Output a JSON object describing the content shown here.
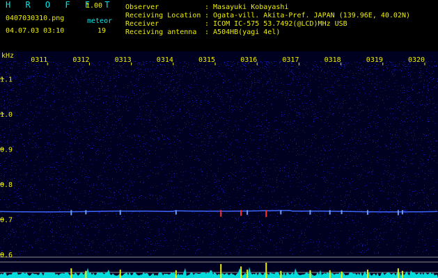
{
  "app": {
    "title": "H R O F F T",
    "version": "1.00",
    "filename": "0407030310.png",
    "datetime": "04.07.03 03:10",
    "meteor_label": "meteor",
    "meteor_count": "19"
  },
  "info": {
    "rows": [
      {
        "label": "Observer",
        "value": ": Masayuki Kobayashi"
      },
      {
        "label": "Receiving Location",
        "value": ": Ogata-vill. Akita-Pref. JAPAN (139.96E, 40.02N)"
      },
      {
        "label": "Receiver",
        "value": ": ICOM IC-575 53.7492(@LCD)MHz USB"
      },
      {
        "label": "Receiving antenna",
        "value": ": A504HB(yagi 4el)"
      }
    ]
  },
  "spectrogram": {
    "unit_label": "kHz",
    "time_ticks": [
      "0311",
      "0312",
      "0313",
      "0314",
      "0315",
      "0316",
      "0317",
      "0318",
      "0319",
      "0320"
    ],
    "freq_ticks": [
      "1.1",
      "1.0",
      "0.9",
      "0.8",
      "0.7",
      "0.6"
    ],
    "freq_range_khz": [
      0.6,
      1.15
    ],
    "carrier_khz": 0.722,
    "meteor_marks": [
      {
        "x_min": 1.55,
        "strength": 0.55
      },
      {
        "x_min": 1.9,
        "strength": 0.35
      },
      {
        "x_min": 2.72,
        "strength": 0.45
      },
      {
        "x_min": 4.05,
        "strength": 0.4
      },
      {
        "x_min": 5.12,
        "strength": 0.9
      },
      {
        "x_min": 5.6,
        "strength": 0.7
      },
      {
        "x_min": 5.75,
        "strength": 0.45
      },
      {
        "x_min": 6.2,
        "strength": 1.0
      },
      {
        "x_min": 6.55,
        "strength": 0.35
      },
      {
        "x_min": 7.25,
        "strength": 0.4
      },
      {
        "x_min": 7.72,
        "strength": 0.4
      },
      {
        "x_min": 8.0,
        "strength": 0.3
      },
      {
        "x_min": 8.62,
        "strength": 0.45
      },
      {
        "x_min": 9.35,
        "strength": 0.55
      },
      {
        "x_min": 9.45,
        "strength": 0.35
      }
    ],
    "colors": {
      "background": "#000020",
      "noise": "#1a1ab4",
      "carrier": "#3c64ff",
      "tick_text": "#f0f000",
      "label_text": "#00e8e8",
      "meteor": "#f0f000",
      "baseline": "#00dcdc"
    }
  }
}
